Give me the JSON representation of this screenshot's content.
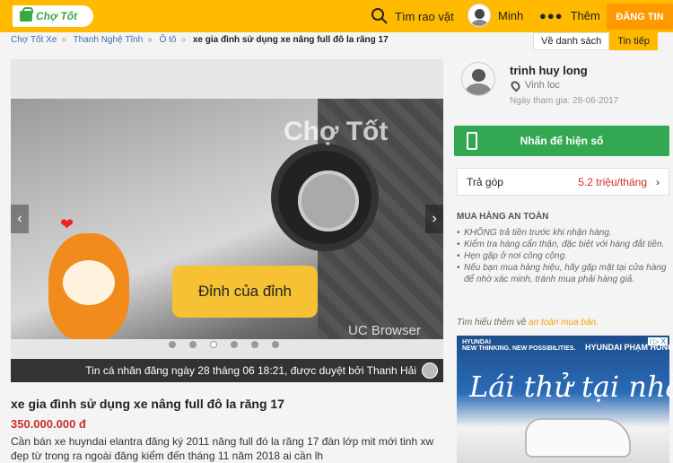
{
  "header": {
    "logo": "Chợ Tốt",
    "search_label": "Tìm rao vặt",
    "user_label": "Minh",
    "more_label": "Thêm",
    "post_label": "ĐĂNG TIN"
  },
  "breadcrumb": [
    "Chợ Tốt Xe",
    "Thanh Nghệ Tĩnh",
    "Ô tô",
    "xe gia đình sử dụng xe nâng full đô la răng 17"
  ],
  "nav": {
    "back": "Về danh sách",
    "next": "Tin tiếp"
  },
  "gallery": {
    "watermark": "Chợ Tốt",
    "sticker": "Đỉnh của đỉnh",
    "app_watermark": "UC Browser",
    "caption": "Tin cá nhân đăng ngày 28 tháng 06 18:21, được duyệt bởi Thanh Hải",
    "total_images": 6,
    "current_index": 3
  },
  "listing": {
    "title": "xe gia đình sử dụng xe nâng full đô la răng 17",
    "price": "350.000.000 đ",
    "description": "Cần bán xe huyndai elantra đăng ký 2011 năng full đó la răng 17 đàn lớp mit mới tinh xw đẹp từ trong ra ngoài đăng kiểm đến tháng 11 năm 2018 ai cần lh"
  },
  "seller": {
    "name": "trinh huy long",
    "location": "Vinh loc",
    "joined": "Ngày tham gia: 28-06-2017"
  },
  "actions": {
    "phone": "Nhấn để hiện số",
    "installment_label": "Trả góp",
    "installment_value": "5.2 triệu/tháng"
  },
  "safe_buy": {
    "title": "MUA HÀNG AN TOÀN",
    "tips": [
      "KHÔNG trả tiền trước khi nhận hàng.",
      "Kiểm tra hàng cẩn thận, đặc biệt với hàng đắt tiền.",
      "Hẹn gặp ở nơi công cộng.",
      "Nếu bạn mua hàng hiệu, hãy gặp mặt tại cửa hàng để nhờ xác minh, tránh mua phải hàng giả."
    ],
    "more_prefix": "Tìm hiểu thêm về",
    "more_link": "an toàn mua bán."
  },
  "ad": {
    "brand": "HYUNDAI",
    "tagline": "NEW THINKING. NEW POSSIBILITIES.",
    "dealer": "HYUNDAI PHẠM HÙNG",
    "slogan": "Lái thử tại nhà",
    "badge": "i ▷ X"
  }
}
